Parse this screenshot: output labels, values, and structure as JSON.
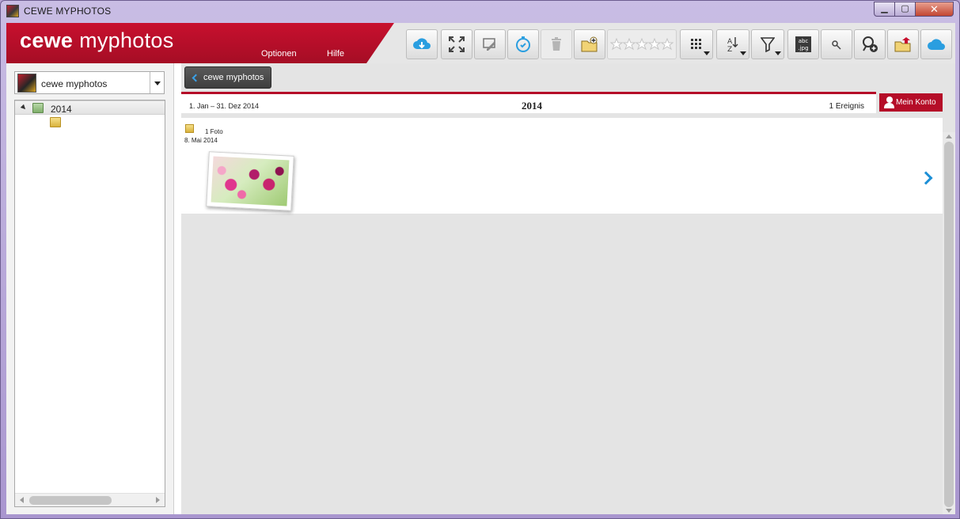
{
  "window": {
    "title": "CEWE MYPHOTOS"
  },
  "header": {
    "logo_bold": "cewe",
    "logo_light": "myphotos",
    "menu": {
      "options": "Optionen",
      "help": "Hilfe"
    }
  },
  "toolbar": {
    "icons": [
      "cloud-download-icon",
      "fullscreen-icon",
      "edit-icon",
      "timer-icon",
      "trash-icon",
      "new-folder-icon",
      "rating-stars-icon",
      "grid-view-icon",
      "sort-az-icon",
      "filter-icon",
      "filename-icon",
      "person-search-icon",
      "add-person-icon",
      "export-icon",
      "cloud-icon"
    ],
    "filename_text": "abc\n.jpg"
  },
  "sidebar": {
    "source_label": "cewe myphotos",
    "tree": [
      {
        "label": "2014",
        "selected": true
      },
      {
        "label": ""
      }
    ]
  },
  "main": {
    "back_label": "cewe myphotos",
    "range": "1. Jan – 31. Dez 2014",
    "year": "2014",
    "event_count": "1 Ereignis",
    "account_label": "Mein Konto",
    "event": {
      "count": "1 Foto",
      "date": "8. Mai 2014"
    }
  },
  "colors": {
    "brand_red": "#c8102e",
    "accent_blue": "#1c8fd6"
  }
}
